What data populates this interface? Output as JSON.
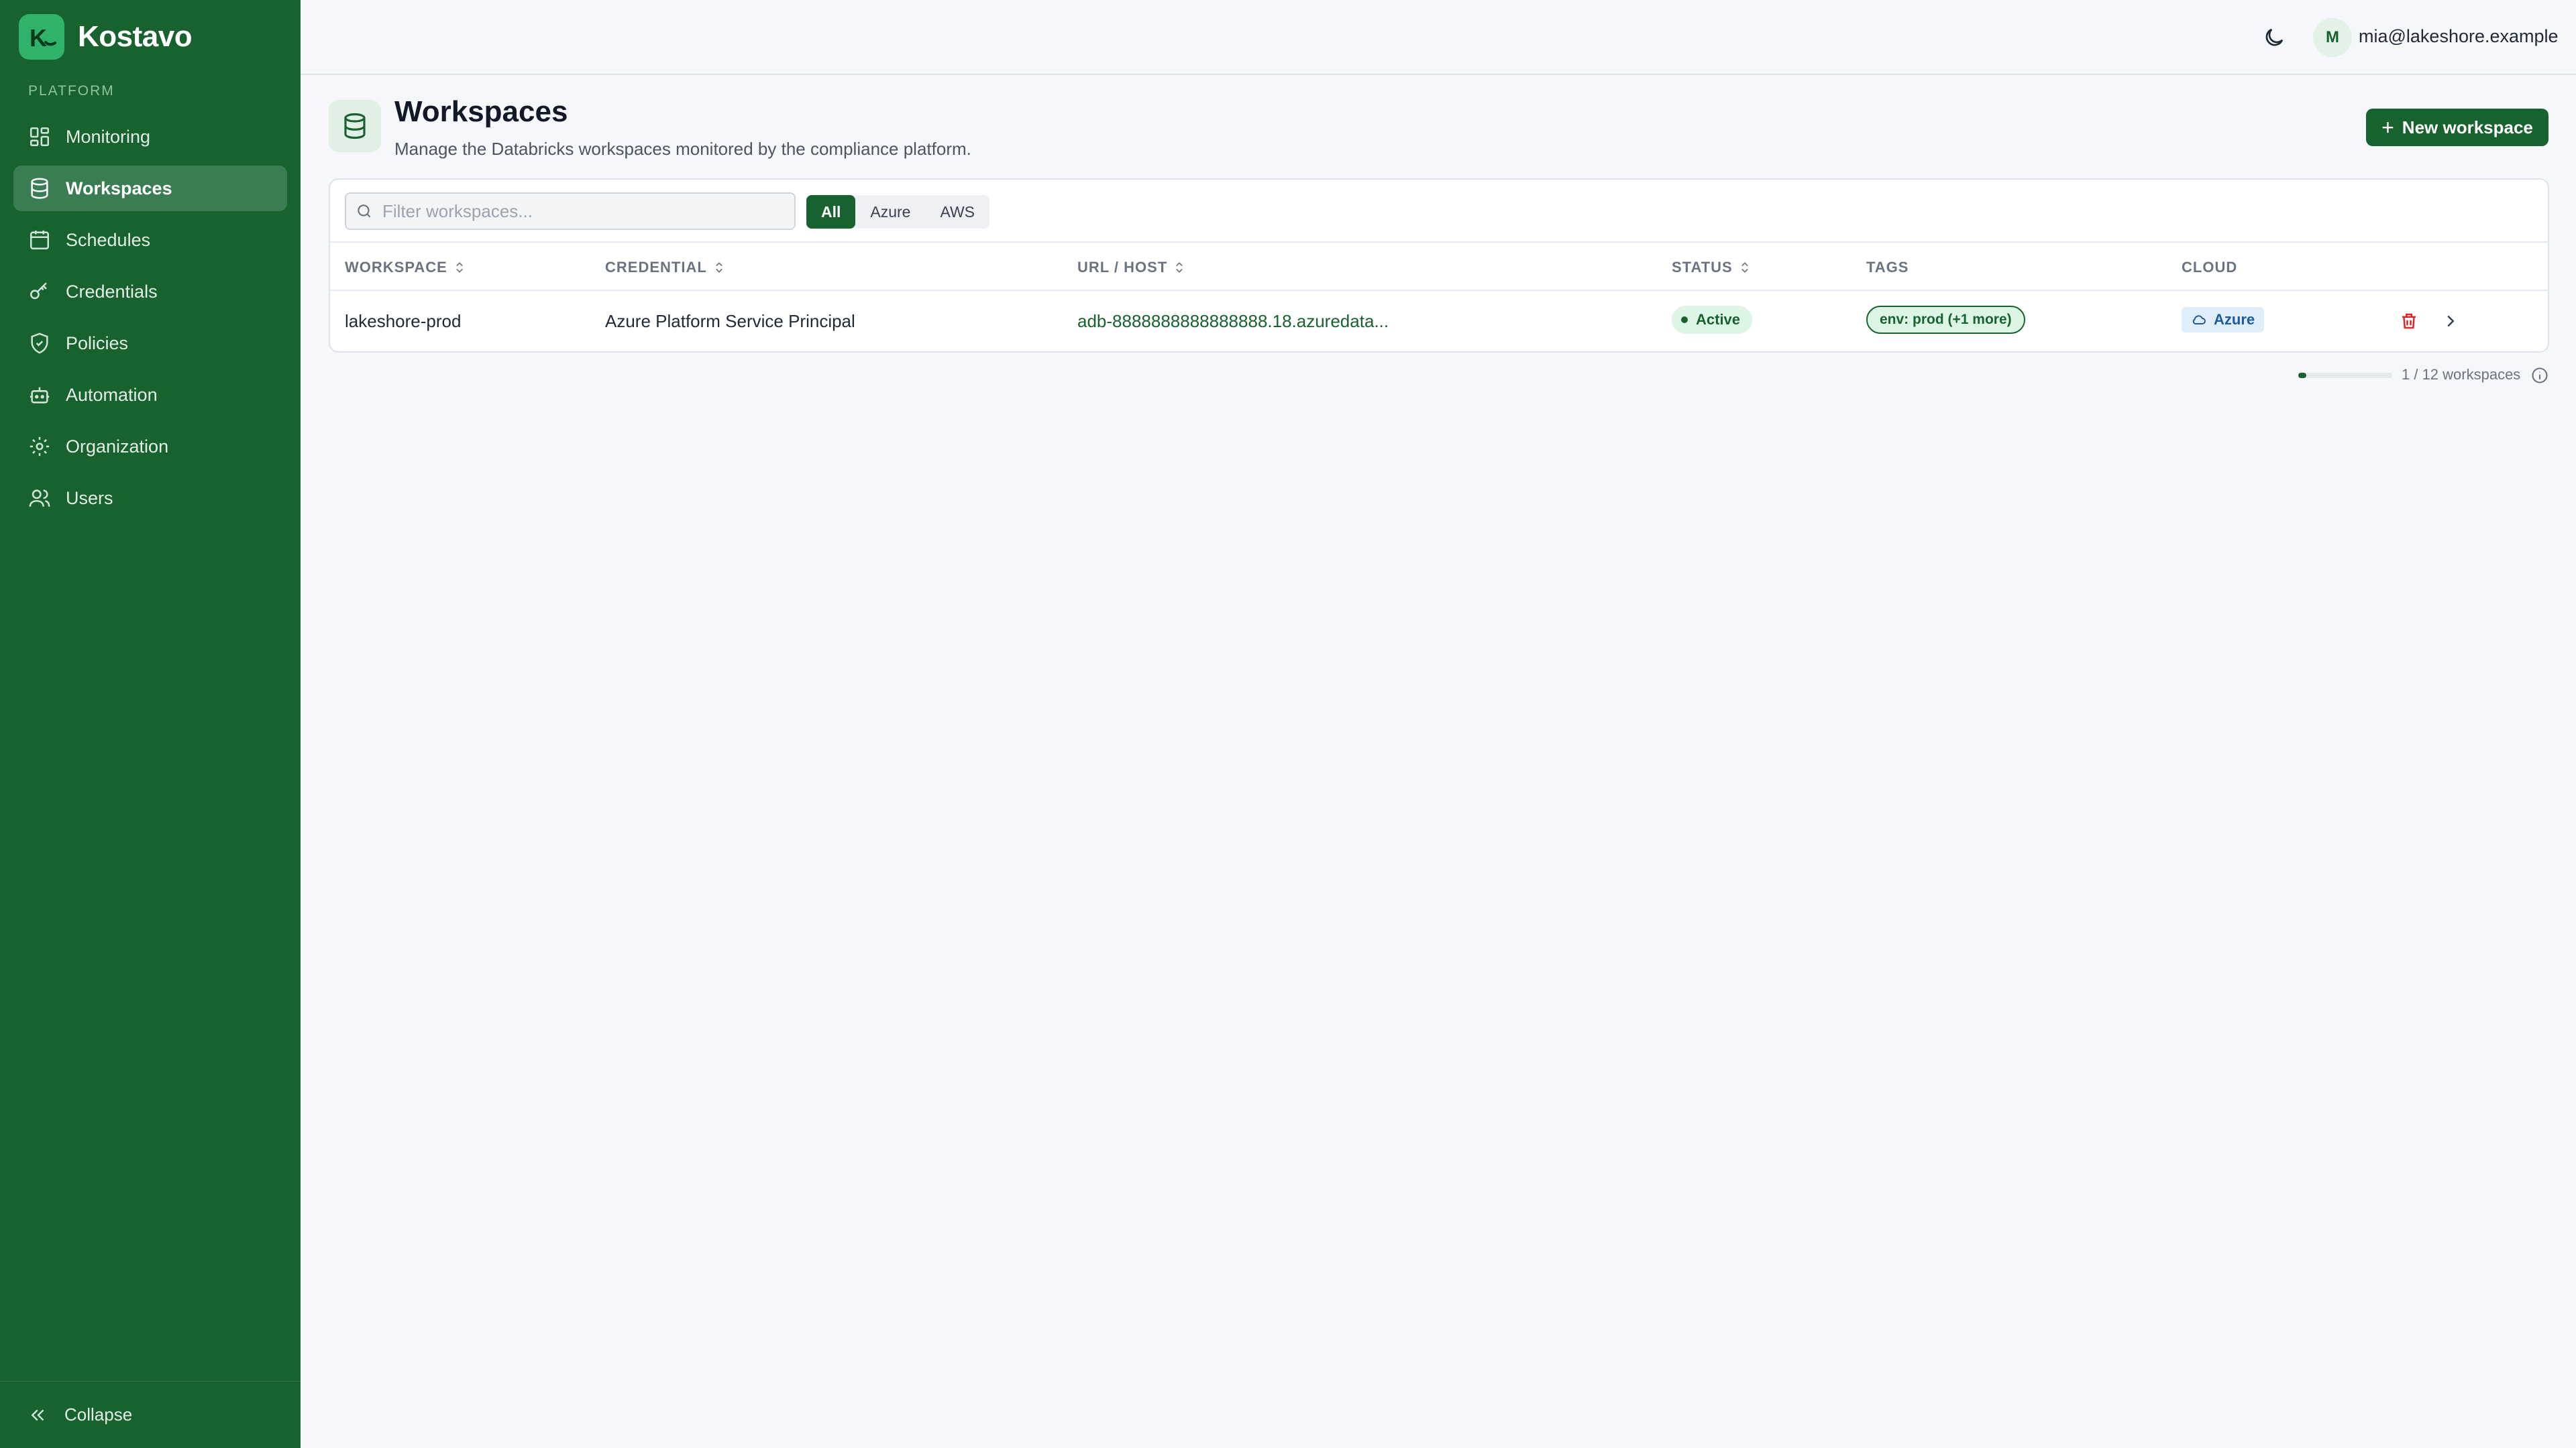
{
  "brand": {
    "name": "Kostavo",
    "logo_letter": "K",
    "accent": "#2fb36b"
  },
  "sidebar": {
    "section_label": "PLATFORM",
    "items": [
      {
        "label": "Monitoring",
        "icon": "dashboard-icon",
        "active": false
      },
      {
        "label": "Workspaces",
        "icon": "database-icon",
        "active": true
      },
      {
        "label": "Schedules",
        "icon": "calendar-icon",
        "active": false
      },
      {
        "label": "Credentials",
        "icon": "key-icon",
        "active": false
      },
      {
        "label": "Policies",
        "icon": "shield-icon",
        "active": false
      },
      {
        "label": "Automation",
        "icon": "robot-icon",
        "active": false
      },
      {
        "label": "Organization",
        "icon": "gear-icon",
        "active": false
      },
      {
        "label": "Users",
        "icon": "users-icon",
        "active": false
      }
    ],
    "collapse_label": "Collapse",
    "background": "#17622e"
  },
  "topbar": {
    "avatar_initial": "M",
    "user_email": "mia@lakeshore.example"
  },
  "header": {
    "title": "Workspaces",
    "subtitle": "Manage the Databricks workspaces monitored by the compliance platform.",
    "new_button_label": "New workspace"
  },
  "toolbar": {
    "search_placeholder": "Filter workspaces...",
    "search_value": "",
    "filters": [
      "All",
      "Azure",
      "AWS"
    ],
    "active_filter": "All"
  },
  "table": {
    "columns": {
      "workspace": "WORKSPACE",
      "credential": "CREDENTIAL",
      "url": "URL / HOST",
      "status": "STATUS",
      "tags": "TAGS",
      "cloud": "CLOUD"
    },
    "rows": [
      {
        "workspace": "lakeshore-prod",
        "credential": "Azure Platform Service Principal",
        "url": "adb-8888888888888888.18.azuredata...",
        "status": "Active",
        "tags": "env: prod (+1 more)",
        "cloud": "Azure"
      }
    ]
  },
  "footer": {
    "count_text": "1 / 12 workspaces",
    "progress": 0.0833
  },
  "colors": {
    "primary": "#17622e",
    "status_bg": "#dcf5e5",
    "cloud_badge_bg": "#e0eefa",
    "danger": "#dc2626"
  }
}
